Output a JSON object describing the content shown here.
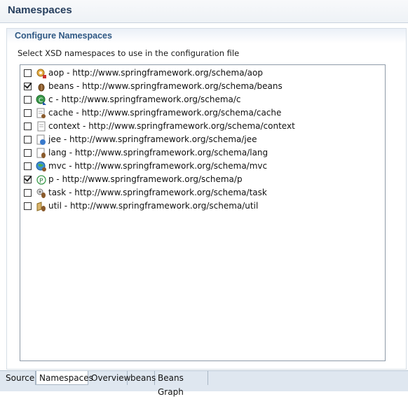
{
  "header": {
    "title": "Namespaces"
  },
  "section": {
    "title": "Configure Namespaces",
    "description": "Select XSD namespaces to use in the configuration file"
  },
  "namespaces": [
    {
      "label": "aop - http://www.springframework.org/schema/aop",
      "checked": false,
      "icon": "aop-icon"
    },
    {
      "label": "beans - http://www.springframework.org/schema/beans",
      "checked": true,
      "icon": "bean-icon"
    },
    {
      "label": "c - http://www.springframework.org/schema/c",
      "checked": false,
      "icon": "c-namespace-icon"
    },
    {
      "label": "cache - http://www.springframework.org/schema/cache",
      "checked": false,
      "icon": "cache-icon"
    },
    {
      "label": "context - http://www.springframework.org/schema/context",
      "checked": false,
      "icon": "context-icon"
    },
    {
      "label": "jee - http://www.springframework.org/schema/jee",
      "checked": false,
      "icon": "jee-icon"
    },
    {
      "label": "lang - http://www.springframework.org/schema/lang",
      "checked": false,
      "icon": "lang-icon"
    },
    {
      "label": "mvc - http://www.springframework.org/schema/mvc",
      "checked": false,
      "icon": "globe-icon"
    },
    {
      "label": "p - http://www.springframework.org/schema/p",
      "checked": true,
      "icon": "p-namespace-icon"
    },
    {
      "label": "task - http://www.springframework.org/schema/task",
      "checked": false,
      "icon": "task-icon"
    },
    {
      "label": "util - http://www.springframework.org/schema/util",
      "checked": false,
      "icon": "util-icon"
    }
  ],
  "tabs": [
    {
      "label": "Source",
      "active": false
    },
    {
      "label": "Namespaces",
      "active": true
    },
    {
      "label": "Overview",
      "active": false
    },
    {
      "label": "beans",
      "active": false
    },
    {
      "label": "Beans Graph",
      "active": false
    }
  ],
  "colors": {
    "header_title": "#273f5e",
    "section_title": "#2d5783",
    "tab_bar": "#dfe7f0"
  }
}
